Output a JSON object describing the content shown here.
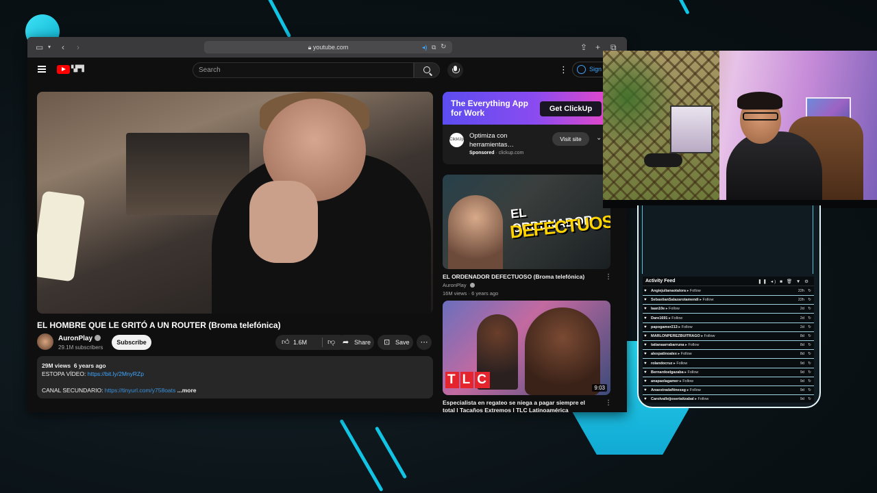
{
  "colors": {
    "accent": "#11c4e4",
    "yt_red": "#ff0000",
    "link": "#3ea6ff"
  },
  "browser": {
    "url": "youtube.com",
    "icons": [
      "sidebar-icon",
      "chevron-down-icon",
      "back-icon",
      "forward-icon",
      "reader-icon",
      "lock-icon",
      "audio-icon",
      "translate-icon",
      "reload-icon",
      "share-icon",
      "new-tab-icon",
      "tabs-icon"
    ]
  },
  "youtube": {
    "search_placeholder": "Search",
    "signin_label": "Sign",
    "menu_glyph": "⋮",
    "video": {
      "title": "EL HOMBRE QUE LE GRITÓ A UN ROUTER (Broma telefónica)",
      "channel": "AuronPlay",
      "subscribers": "29.1M subscribers",
      "subscribe_label": "Subscribe",
      "likes": "1.6M",
      "share_label": "Share",
      "save_label": "Save",
      "more_glyph": "⋯"
    },
    "description": {
      "views": "29M views",
      "age": "6 years ago",
      "line1_prefix": "ESTOPA VÍDEO: ",
      "line1_link": "https://bit.ly/2MnyRZp",
      "line3_prefix": "CANAL SECUNDARIO: ",
      "line3_link": "https://tinyurl.com/y758oats",
      "more": "...more"
    },
    "ad": {
      "headline_line1": "The Everything App",
      "headline_line2": "for Work",
      "cta": "Get ClickUp",
      "logo_text": "ClickUp",
      "text": "Optimiza con herramientas…",
      "sponsored": "Sponsored",
      "domain": "clickup.com",
      "visit_label": "Visit site"
    },
    "recommendations": [
      {
        "thumb_line1": "EL ORDENADOR",
        "thumb_line2": "DEFECTUOSO",
        "title": "EL ORDENADOR DEFECTUOSO (Broma telefónica)",
        "channel": "AuronPlay",
        "views": "16M views",
        "age": "6 years ago"
      },
      {
        "thumb_logo": [
          "T",
          "L",
          "C"
        ],
        "duration": "9:03",
        "title": "Especialista en regateo se niega a pagar siempre el total | Tacaños Extremos | TLC Latinoamérica"
      }
    ]
  },
  "activity_feed": {
    "title": "Activity Feed",
    "controls": "❚❚ ◂) ■ 🗑 ▼ ⚙",
    "rows": [
      {
        "name": "Angiejulianaotalora",
        "event": "Follow",
        "time": "22h"
      },
      {
        "name": "SebastianSalazarotamendi",
        "event": "Follow",
        "time": "22h"
      },
      {
        "name": "laan10e",
        "event": "Follow",
        "time": "2d"
      },
      {
        "name": "Dare1691",
        "event": "Follow",
        "time": "2d"
      },
      {
        "name": "papogamer213",
        "event": "Follow",
        "time": "2d"
      },
      {
        "name": "MARLONPEREZBUITRAGO",
        "event": "Follow",
        "time": "8d"
      },
      {
        "name": "tatianaarrabarruna",
        "event": "Follow",
        "time": "8d"
      },
      {
        "name": "alexpatinoalex",
        "event": "Follow",
        "time": "8d"
      },
      {
        "name": "rolandocruz",
        "event": "Follow",
        "time": "9d"
      },
      {
        "name": "Bernardoelgazaba",
        "event": "Follow",
        "time": "9d"
      },
      {
        "name": "anapaolagamer",
        "event": "Follow",
        "time": "9d"
      },
      {
        "name": "Anaestradafitnessg",
        "event": "Follow",
        "time": "9d"
      },
      {
        "name": "Carolvalle|joseriaitzabal",
        "event": "Follow",
        "time": "9d"
      }
    ]
  }
}
